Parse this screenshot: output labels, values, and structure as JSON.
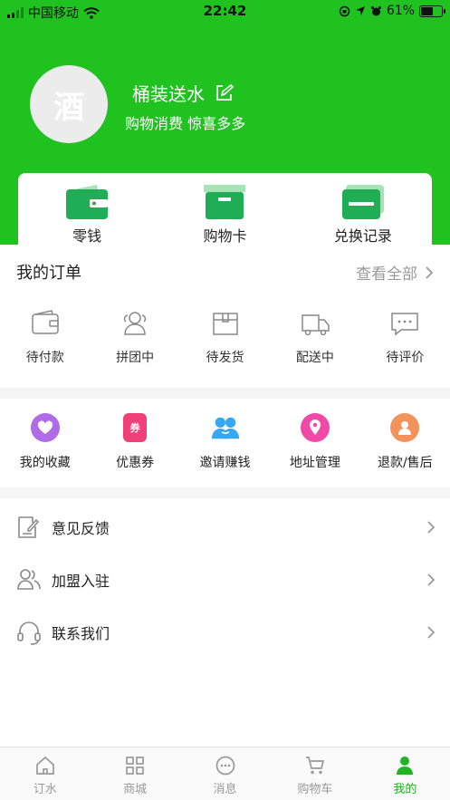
{
  "status_bar": {
    "carrier": "中国移动",
    "time": "22:42",
    "battery": "61%",
    "battery_level": 0.61,
    "signal_bars": 2
  },
  "profile": {
    "avatar_char": "酒",
    "name": "桶装送水",
    "slogan": "购物消费 惊喜多多"
  },
  "wallet": [
    {
      "label": "零钱",
      "icon": "wallet-icon"
    },
    {
      "label": "购物卡",
      "icon": "card-box-icon"
    },
    {
      "label": "兑换记录",
      "icon": "card-stack-icon"
    }
  ],
  "orders": {
    "title": "我的订单",
    "view_all": "查看全部",
    "items": [
      {
        "label": "待付款",
        "icon": "wallet-outline-icon"
      },
      {
        "label": "拼团中",
        "icon": "group-icon"
      },
      {
        "label": "待发货",
        "icon": "box-icon"
      },
      {
        "label": "配送中",
        "icon": "truck-icon"
      },
      {
        "label": "待评价",
        "icon": "comment-icon"
      }
    ]
  },
  "services": [
    {
      "label": "我的收藏",
      "icon": "heart-icon",
      "color": "#b06be8"
    },
    {
      "label": "优惠券",
      "icon": "coupon-icon",
      "color": "#f0407a"
    },
    {
      "label": "邀请赚钱",
      "icon": "invite-icon",
      "color": "#36a8f0"
    },
    {
      "label": "地址管理",
      "icon": "location-icon",
      "color": "#f049a8"
    },
    {
      "label": "退款/售后",
      "icon": "refund-icon",
      "color": "#f3925a"
    }
  ],
  "menu": [
    {
      "label": "意见反馈",
      "icon": "feedback-icon"
    },
    {
      "label": "加盟入驻",
      "icon": "join-icon"
    },
    {
      "label": "联系我们",
      "icon": "headset-icon"
    }
  ],
  "tabbar": {
    "active": 4,
    "active_color": "#1fb51f",
    "items": [
      {
        "label": "订水",
        "icon": "home-icon"
      },
      {
        "label": "商城",
        "icon": "grid-icon"
      },
      {
        "label": "消息",
        "icon": "message-icon"
      },
      {
        "label": "购物车",
        "icon": "cart-icon"
      },
      {
        "label": "我的",
        "icon": "user-icon"
      }
    ]
  },
  "colors": {
    "brand_green": "#1fc21f",
    "muted_gray": "#9a9a9a"
  }
}
